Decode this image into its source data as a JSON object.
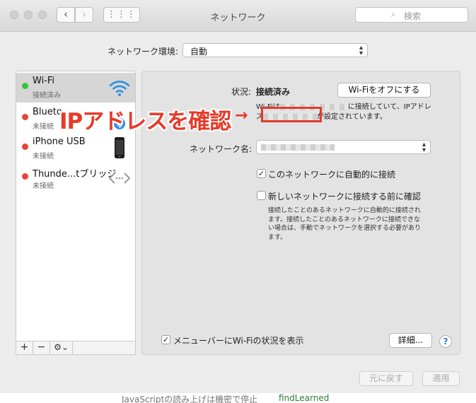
{
  "window": {
    "title": "ネットワーク",
    "grid_glyph": "⋮⋮⋮"
  },
  "search": {
    "placeholder": "検索",
    "icon": "magnifier-icon"
  },
  "location": {
    "label": "ネットワーク環境:",
    "value": "自動"
  },
  "services": [
    {
      "name": "Wi-Fi",
      "status": "接続済み",
      "color": "#34c535",
      "icon": "wifi-icon"
    },
    {
      "name": "Blueto",
      "status": "未接続",
      "color": "#e8443a",
      "icon": "bluetooth-icon"
    },
    {
      "name": "iPhone USB",
      "status": "未接続",
      "color": "#e8443a",
      "icon": "iphone-icon"
    },
    {
      "name": "Thunde...tブリッジ",
      "status": "未接続",
      "color": "#e8443a",
      "icon": "thunderbolt-bridge-icon"
    }
  ],
  "sidebar_buttons": {
    "add": "+",
    "remove": "−",
    "action": "⚙⌄"
  },
  "detail": {
    "status_label": "状況:",
    "status_value": "接続済み",
    "toggle_button": "Wi-Fiをオフにする",
    "desc_line1_pre": "Wi-Fiは",
    "desc_line1_post": "に接続していて、IPアドレ",
    "desc_line2_pre": "ス",
    "desc_line2_post": "が設定されています。",
    "network_name_label": "ネットワーク名:",
    "auto_join": {
      "label": "このネットワークに自動的に接続",
      "checked": true
    },
    "ask_join": {
      "label": "新しいネットワークに接続する前に確認",
      "checked": false
    },
    "ask_join_help": [
      "接続したことのあるネットワークに自動的に接続され",
      "ます。接続したことのあるネットワークに接続できな",
      "い場合は、手動でネットワークを選択する必要があり",
      "ます。"
    ],
    "menubar": {
      "label": "メニューバーにWi-Fiの状況を表示",
      "checked": true
    },
    "advanced_button": "詳細...",
    "help": "?"
  },
  "footer": {
    "revert": "元に戻す",
    "apply": "適用"
  },
  "annotation": {
    "text": "IPアドレスを確認",
    "arrow": "→",
    "color": "#e63a2a"
  },
  "background": {
    "text_left": "JavaScriptの読み上げは機密で停止",
    "text_right": "findLearned"
  }
}
